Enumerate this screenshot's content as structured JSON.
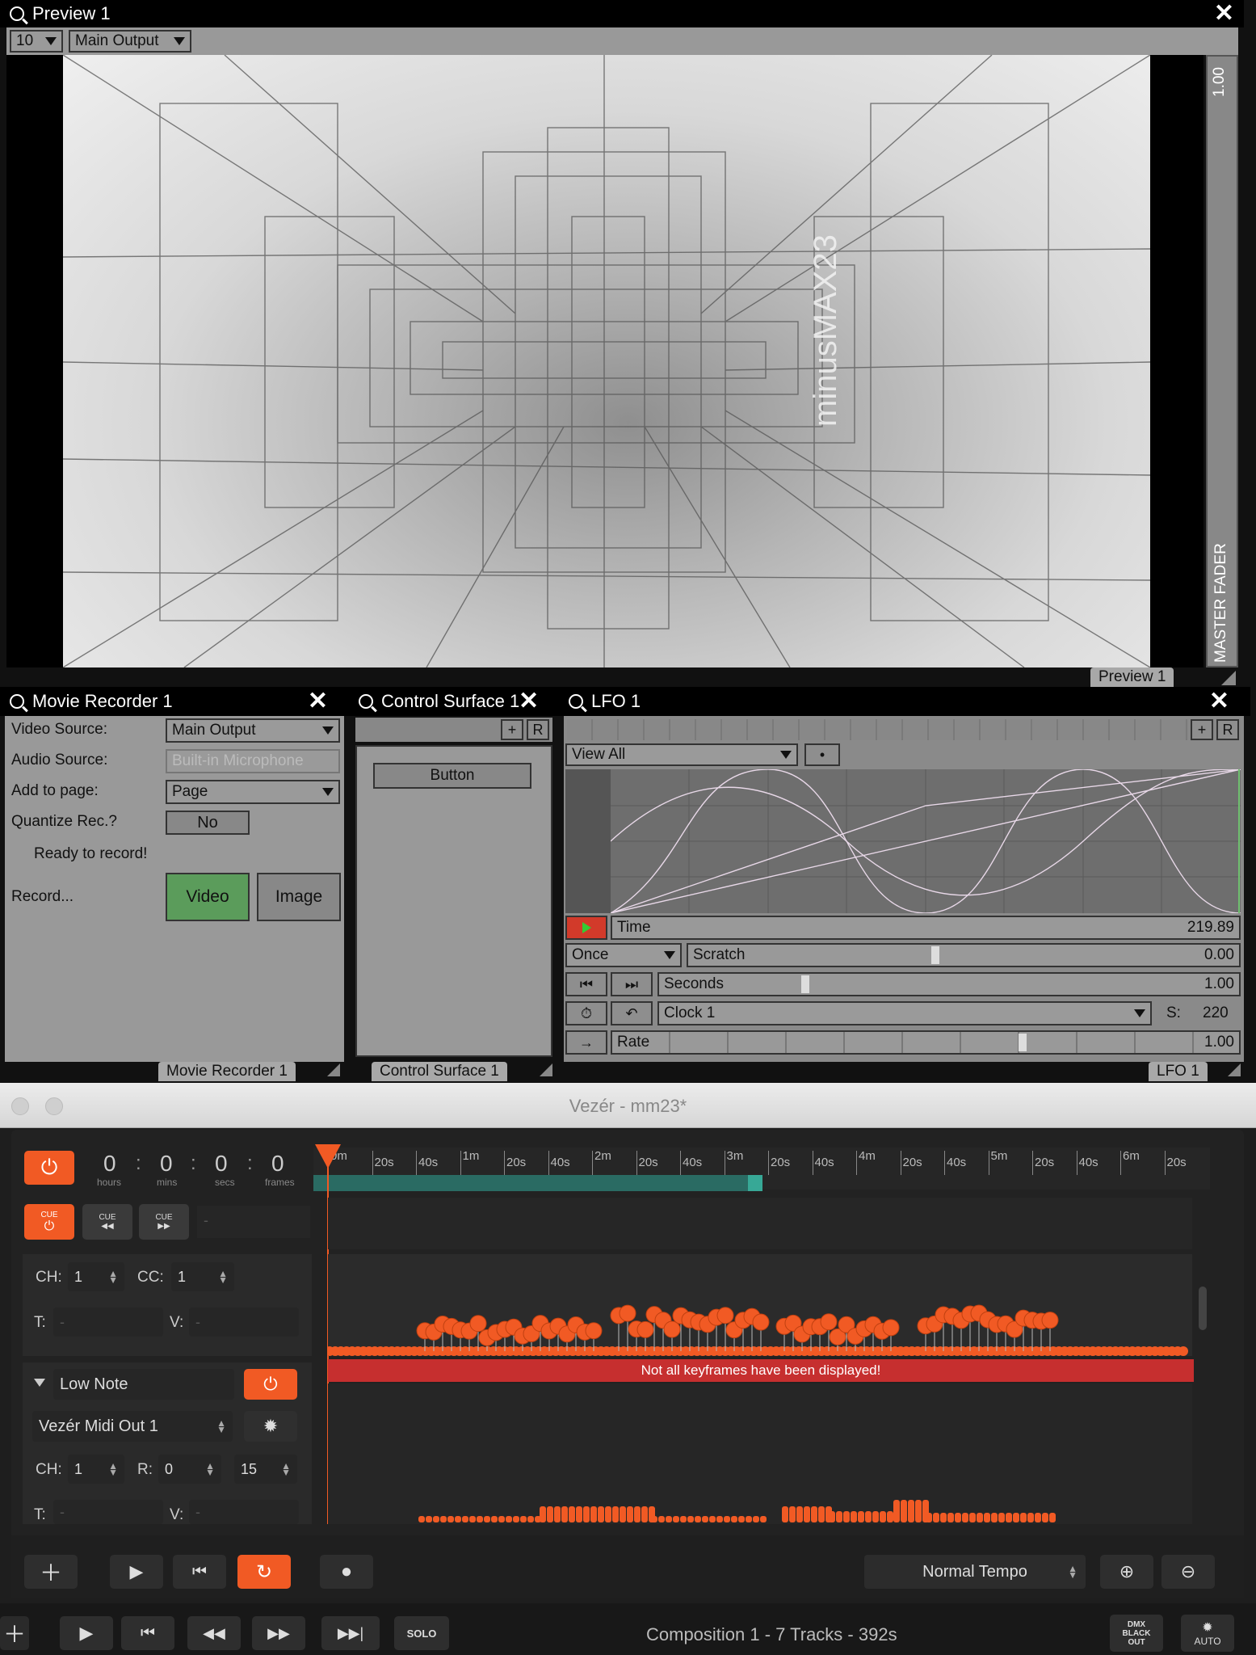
{
  "preview": {
    "title": "Preview 1",
    "zoom_value": "10",
    "output_value": "Main Output",
    "watermark": "minusMAX23",
    "fader_value": "1.00",
    "fader_label": "MASTER FADER",
    "tab_label": "Preview 1"
  },
  "movie_recorder": {
    "title": "Movie Recorder 1",
    "video_source_label": "Video Source:",
    "video_source_value": "Main Output",
    "audio_source_label": "Audio Source:",
    "audio_source_value": "Built-in Microphone",
    "add_to_page_label": "Add to page:",
    "add_to_page_value": "Page",
    "quantize_label": "Quantize Rec.?",
    "quantize_value": "No",
    "status": "Ready to record!",
    "record_label": "Record...",
    "video_button": "Video",
    "image_button": "Image",
    "tab_label": "Movie Recorder 1"
  },
  "control_surface": {
    "title": "Control Surface 1",
    "plus": "+",
    "r": "R",
    "button_label": "Button",
    "tab_label": "Control Surface 1"
  },
  "lfo": {
    "title": "LFO 1",
    "plus": "+",
    "r": "R",
    "view_value": "View All",
    "time_label": "Time",
    "time_value": "219.89",
    "mode_value": "Once",
    "scratch_label": "Scratch",
    "scratch_value": "0.00",
    "scratch_fraction": 0.45,
    "seconds_label": "Seconds",
    "seconds_value": "1.00",
    "seconds_fraction": 0.25,
    "clock_value": "Clock 1",
    "s_label": "S:",
    "s_value": "220",
    "rate_label": "Rate",
    "rate_value": "1.00",
    "rate_fraction": 0.66,
    "tab_label": "LFO 1"
  },
  "vezer": {
    "window_title": "Vezér - mm23*",
    "timecode": {
      "hours": "0",
      "mins": "0",
      "secs": "0",
      "frames": "0",
      "hours_label": "hours",
      "mins_label": "mins",
      "secs_label": "secs",
      "frames_label": "frames"
    },
    "cue_labels": [
      "CUE",
      "CUE",
      "CUE"
    ],
    "ruler_ticks": [
      "0m",
      "20s",
      "40s",
      "1m",
      "20s",
      "40s",
      "2m",
      "20s",
      "40s",
      "3m",
      "20s",
      "40s",
      "4m",
      "20s",
      "40s",
      "5m",
      "20s",
      "40s",
      "6m",
      "20s"
    ],
    "track1": {
      "ch_label": "CH:",
      "ch_value": "1",
      "cc_label": "CC:",
      "cc_value": "1",
      "t_label": "T:",
      "t_value": "-",
      "v_label": "V:",
      "v_value": "-"
    },
    "warning": "Not all keyframes have been displayed!",
    "track2": {
      "name": "Low Note",
      "output": "Vezér Midi Out 1",
      "ch_label": "CH:",
      "ch_value": "1",
      "r_label": "R:",
      "r_value": "0",
      "r_max": "15",
      "t_label": "T:",
      "t_value": "-",
      "v_label": "V:",
      "v_value": "-"
    },
    "tempo_value": "Normal Tempo",
    "solo_label": "SOLO",
    "status": "Composition 1 - 7 Tracks - 392s",
    "dmx_label": "DMX BLACK OUT",
    "auto_label": "AUTO",
    "accent_color": "#f15a24"
  }
}
